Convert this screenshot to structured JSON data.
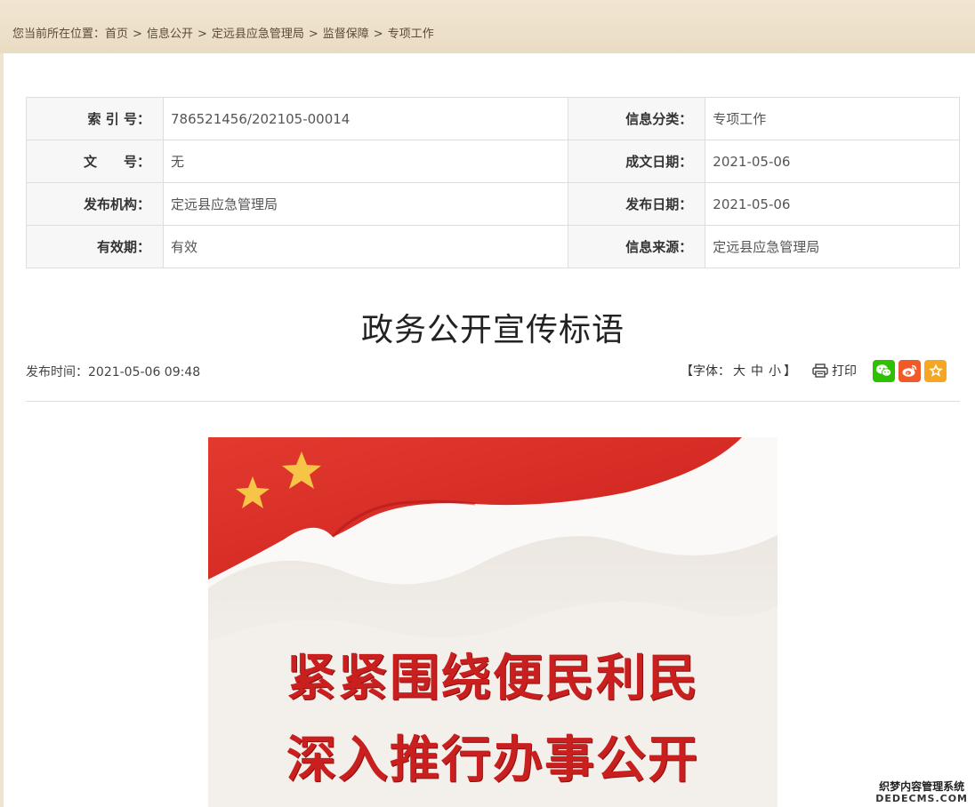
{
  "breadcrumb": {
    "prefix": "您当前所在位置：",
    "items": [
      "首页",
      "信息公开",
      "定远县应急管理局",
      "监督保障",
      "专项工作"
    ],
    "separator": ">"
  },
  "meta": {
    "rows": [
      {
        "k1": "索 引 号：",
        "v1": "786521456/202105-00014",
        "k2": "信息分类：",
        "v2": "专项工作"
      },
      {
        "k1": "文　　号：",
        "v1": "无",
        "k2": "成文日期：",
        "v2": "2021-05-06"
      },
      {
        "k1": "发布机构：",
        "v1": "定远县应急管理局",
        "k2": "发布日期：",
        "v2": "2021-05-06"
      },
      {
        "k1": "有效期：",
        "v1": "有效",
        "k2": "信息来源：",
        "v2": "定远县应急管理局"
      }
    ]
  },
  "article": {
    "title": "政务公开宣传标语",
    "pub_time": "发布时间：2021-05-06 09:48"
  },
  "tools": {
    "font_open": "【字体：",
    "font_large": "大",
    "font_medium": "中",
    "font_small": "小",
    "font_close": "】",
    "print_label": "打印",
    "share_icons": [
      "wechat-icon",
      "weibo-icon",
      "favorite-icon"
    ]
  },
  "poster": {
    "line1": "紧紧围绕便民利民",
    "line2": "深入推行办事公开"
  },
  "watermark": {
    "line1": "织梦内容管理系统",
    "line2": "DEDECMS.COM"
  },
  "colors": {
    "accent_red": "#c9201f",
    "wechat": "#2dc100",
    "weibo": "#f05a26",
    "favorite": "#f5a623",
    "header_bg": "#efe4cf"
  }
}
